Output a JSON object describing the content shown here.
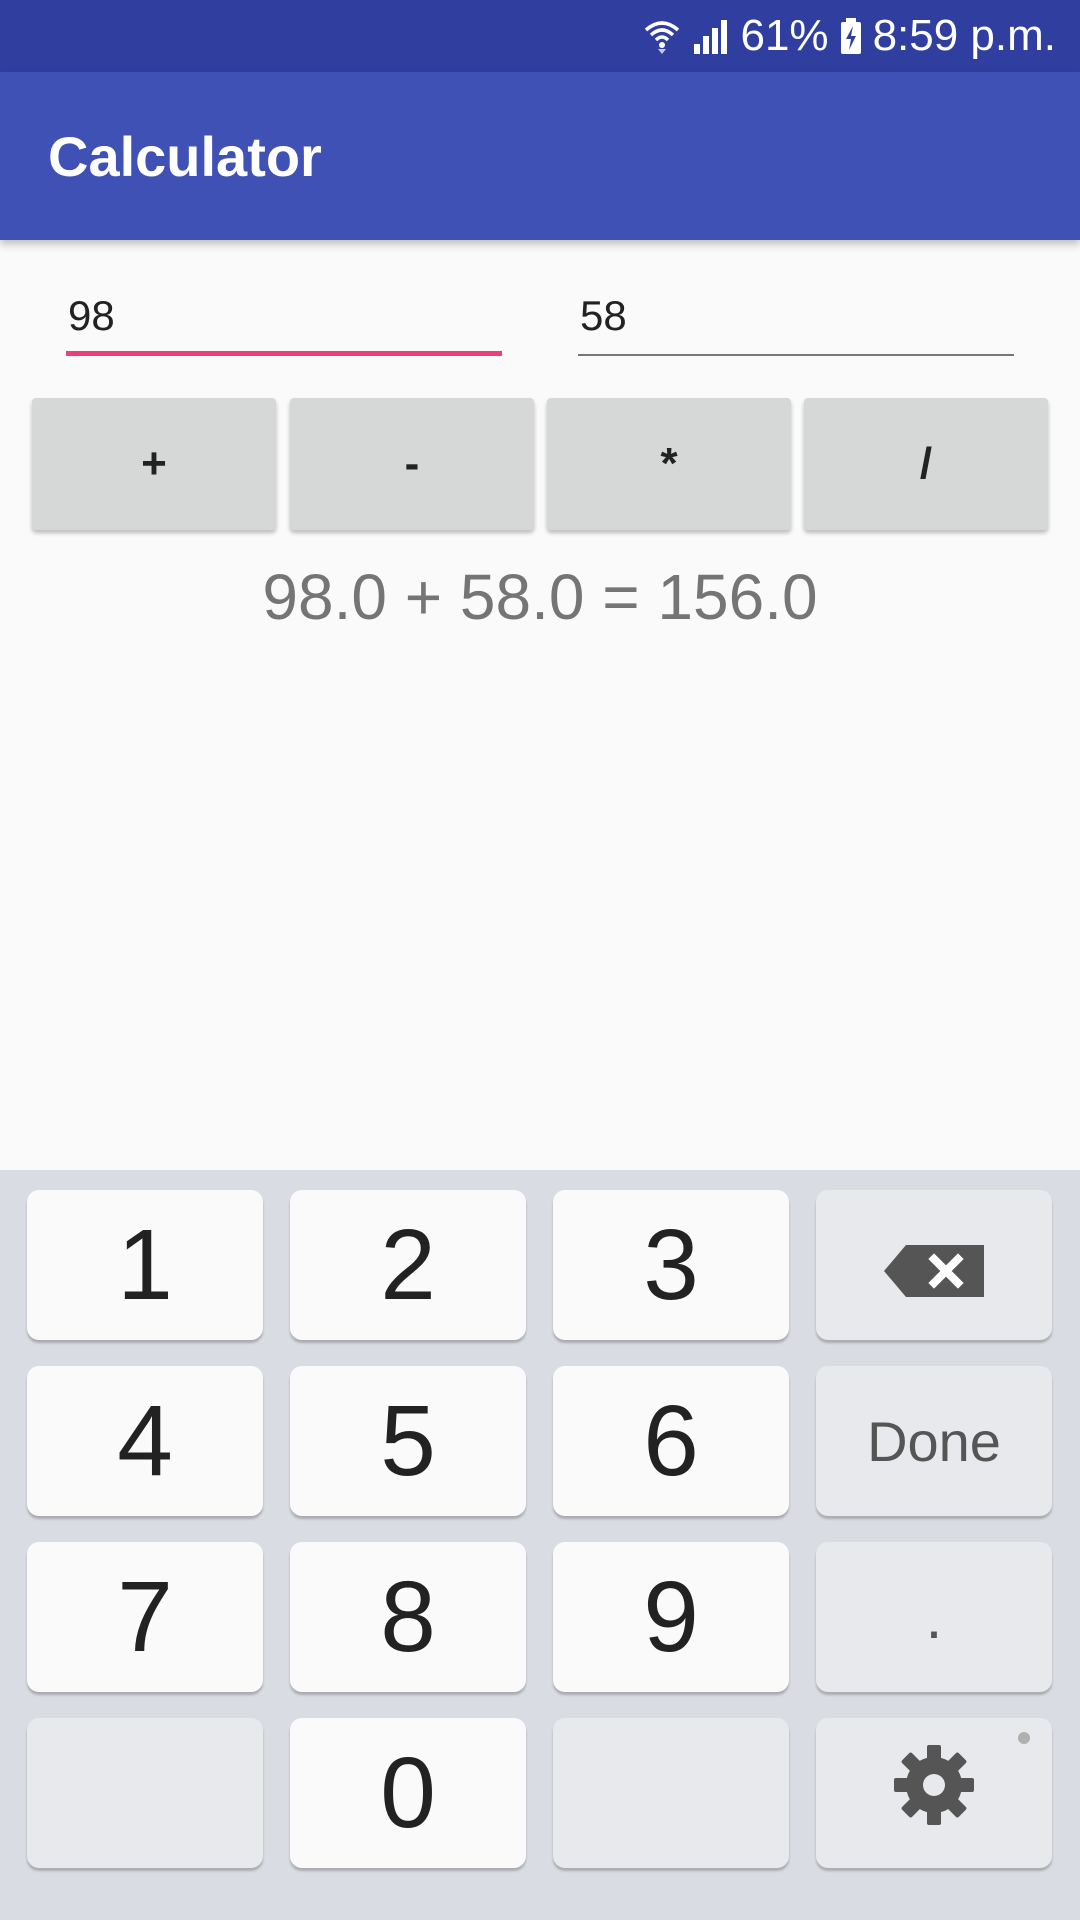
{
  "status": {
    "battery": "61%",
    "time": "8:59 p.m."
  },
  "app": {
    "title": "Calculator"
  },
  "inputs": {
    "first": "98",
    "second": "58"
  },
  "operators": [
    "+",
    "-",
    "*",
    "/"
  ],
  "result": "98.0 + 58.0 = 156.0",
  "keyboard": {
    "k1": "1",
    "k2": "2",
    "k3": "3",
    "k4": "4",
    "k5": "5",
    "k6": "6",
    "k7": "7",
    "k8": "8",
    "k9": "9",
    "k0": "0",
    "done": "Done",
    "dot": "."
  },
  "colors": {
    "status_bar": "#303f9f",
    "app_bar": "#3f51b5",
    "accent": "#ec407a"
  },
  "icons": {
    "wifi": "wifi-icon",
    "signal": "signal-icon",
    "battery": "battery-charging-icon",
    "backspace": "backspace-icon",
    "settings": "gear-icon"
  }
}
